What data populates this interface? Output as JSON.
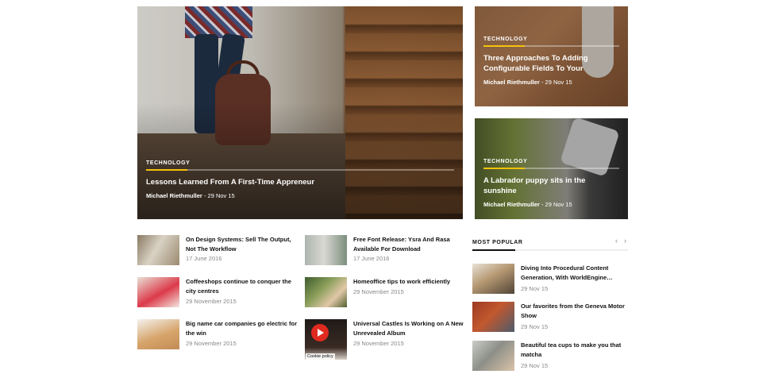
{
  "hero_main": {
    "category": "TECHNOLOGY",
    "title": "Lessons Learned From A First-Time Appreneur",
    "author": "Michael Riethmuller",
    "date": "29 Nov 15"
  },
  "hero_top": {
    "category": "TECHNOLOGY",
    "title": "Three Approaches To Adding Configurable Fields To Your",
    "author": "Michael Riethmuller",
    "date": "29 Nov 15"
  },
  "hero_bottom": {
    "category": "TECHNOLOGY",
    "title": "A Labrador puppy sits in the sunshine",
    "author": "Michael Riethmuller",
    "date": "29 Nov 15"
  },
  "articles": [
    {
      "title": "On Design Systems: Sell The Output, Not The Workflow",
      "date": "17 June 2016"
    },
    {
      "title": "Free Font Release: Ysra And Rasa Available For Download",
      "date": "17 June 2016"
    },
    {
      "title": "Coffeeshops continue to conquer the city centres",
      "date": "29 November 2015"
    },
    {
      "title": "Homeoffice tips to work efficiently",
      "date": "29 November 2015"
    },
    {
      "title": "Big name car companies go electric for the win",
      "date": "29 November 2015"
    },
    {
      "title": "Universal Castles Is Working on A New Unrevealed Album",
      "date": "29 November 2015"
    }
  ],
  "cookie_label": "Cookie policy",
  "most_popular": {
    "title": "MOST POPULAR",
    "prev_icon": "‹",
    "next_icon": "›",
    "items": [
      {
        "title": "Diving Into Procedural Content Generation, With WorldEngine…",
        "date": "29 Nov 15"
      },
      {
        "title": "Our favorites from the Geneva Motor Show",
        "date": "29 Nov 15"
      },
      {
        "title": "Beautiful tea cups to make you that matcha",
        "date": "29 Nov 15"
      }
    ]
  },
  "colors": {
    "accent": "#f5c20a",
    "play": "#e02a1f"
  }
}
